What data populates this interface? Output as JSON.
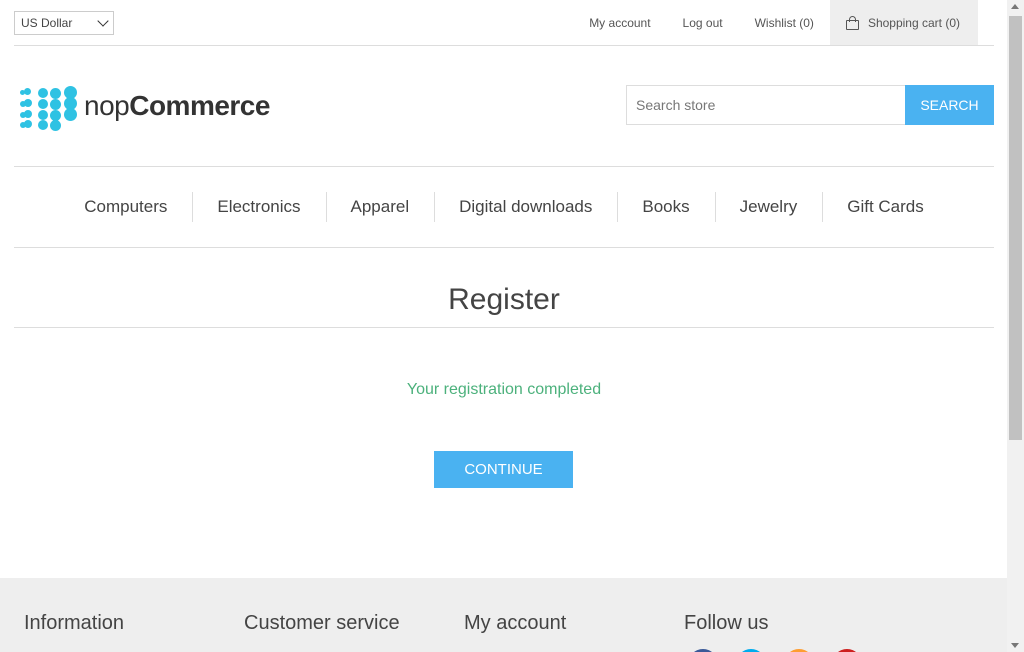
{
  "header": {
    "currency": {
      "selected": "US Dollar"
    },
    "links": {
      "my_account": "My account",
      "log_out": "Log out",
      "wishlist": "Wishlist (0)",
      "shopping_cart": "Shopping cart (0)"
    }
  },
  "logo": {
    "prefix": "nop",
    "brand": "Commerce"
  },
  "search": {
    "placeholder": "Search store",
    "button": "SEARCH"
  },
  "menu": [
    "Computers",
    "Electronics",
    "Apparel",
    "Digital downloads",
    "Books",
    "Jewelry",
    "Gift Cards"
  ],
  "page": {
    "title": "Register",
    "result": "Your registration completed",
    "continue": "CONTINUE"
  },
  "footer": {
    "columns": [
      "Information",
      "Customer service",
      "My account",
      "Follow us"
    ],
    "social_icons": [
      {
        "name": "facebook-icon",
        "color": "#3b5998"
      },
      {
        "name": "twitter-icon",
        "color": "#00aced"
      },
      {
        "name": "rss-icon",
        "color": "#fe9d31"
      },
      {
        "name": "youtube-icon",
        "color": "#cd201f"
      }
    ]
  },
  "colors": {
    "accent": "#4ab2f1",
    "success": "#4cb17c",
    "logo": "#2fc2e3"
  }
}
